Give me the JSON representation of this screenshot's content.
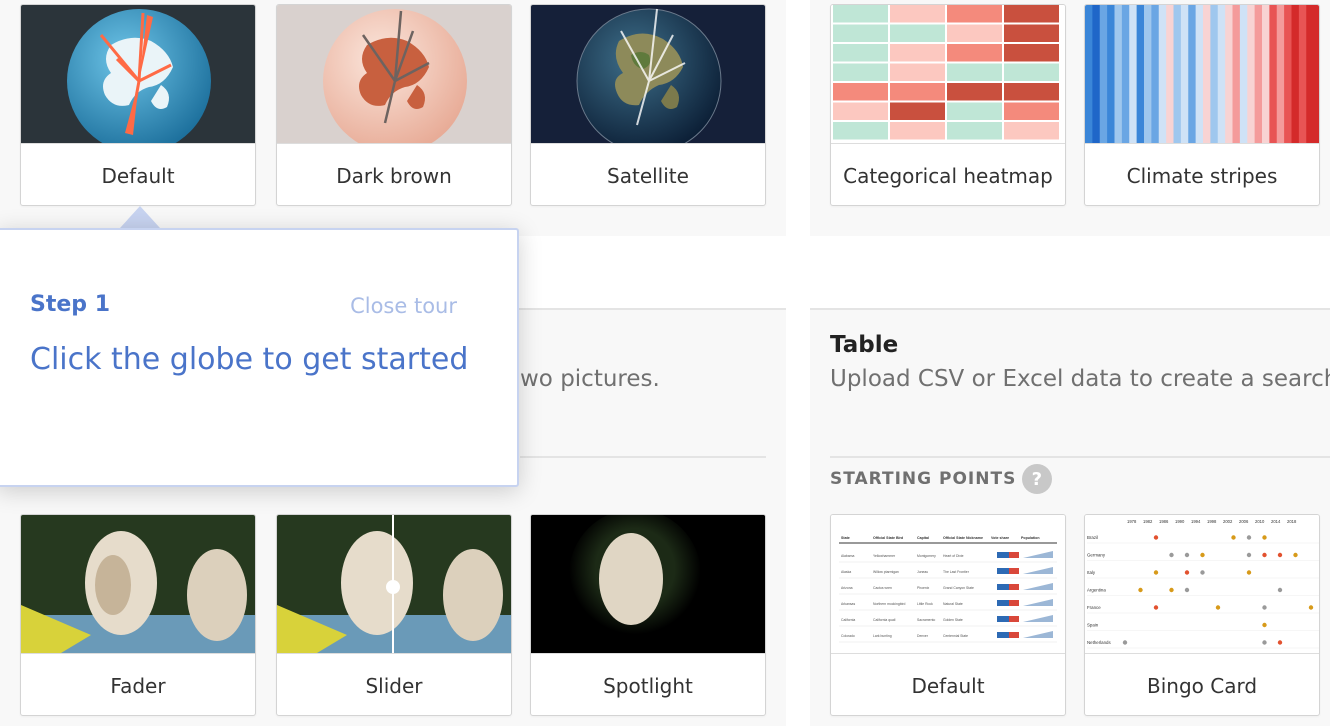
{
  "globe_cards": [
    {
      "label": "Default"
    },
    {
      "label": "Dark brown"
    },
    {
      "label": "Satellite"
    }
  ],
  "chart_cards": [
    {
      "label": "Categorical heatmap"
    },
    {
      "label": "Climate stripes"
    }
  ],
  "partial_desc": "wo pictures.",
  "compare_cards": [
    {
      "label": "Fader"
    },
    {
      "label": "Slider"
    },
    {
      "label": "Spotlight"
    }
  ],
  "table_section": {
    "title": "Table",
    "description": "Upload CSV or Excel data to create a searcha",
    "starting_points_label": "STARTING POINTS",
    "help": "?",
    "cards": [
      {
        "label": "Default"
      },
      {
        "label": "Bingo Card"
      }
    ]
  },
  "tour": {
    "step": "Step 1",
    "close": "Close tour",
    "message": "Click the globe to get started"
  },
  "table_thumb": {
    "headers": [
      "State",
      "Official State Bird",
      "Capital",
      "Official State Nickname",
      "Vote share",
      "Population"
    ],
    "rows": [
      [
        "Alabama",
        "Yellowhammer",
        "Montgomery",
        "Heart of Dixie"
      ],
      [
        "Alaska",
        "Willow ptarmigan",
        "Juneau",
        "The Last Frontier"
      ],
      [
        "Arizona",
        "Cactus wren",
        "Phoenix",
        "Grand Canyon State"
      ],
      [
        "Arkansas",
        "Northern mockingbird",
        "Little Rock",
        "Natural State"
      ],
      [
        "California",
        "California quail",
        "Sacramento",
        "Golden State"
      ],
      [
        "Colorado",
        "Lark bunting",
        "Denver",
        "Centennial State"
      ]
    ]
  },
  "bingo_thumb": {
    "years": [
      "1978",
      "1982",
      "1986",
      "1990",
      "1994",
      "1998",
      "2002",
      "2006",
      "2010",
      "2014",
      "2018"
    ],
    "countries": [
      "Brazil",
      "Germany",
      "Italy",
      "Argentina",
      "France",
      "Spain",
      "Netherlands"
    ]
  },
  "colors": {
    "tour_accent": "#4a74c9",
    "tour_close": "#a9bce6",
    "panel_bg": "#f8f8f8"
  }
}
